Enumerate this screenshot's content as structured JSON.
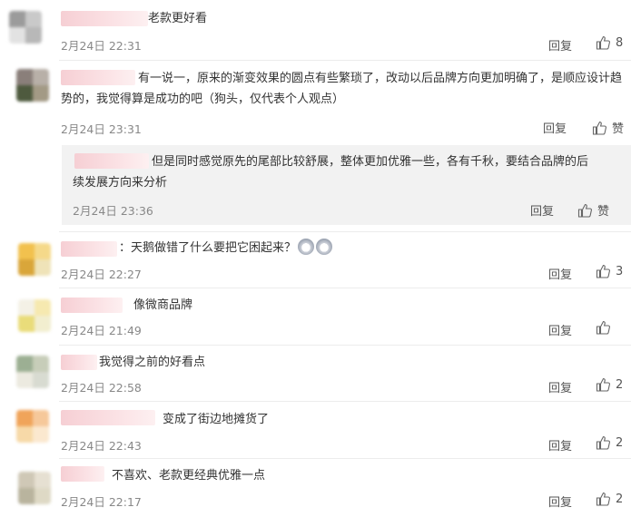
{
  "reply_label": "回复",
  "like_label_zero": "赞",
  "comments": [
    {
      "text": "老款更好看",
      "time": "2月24日 22:31",
      "likes": "8",
      "avatar_colors": [
        "#9b9b9b",
        "#c9c9c9",
        "#e2e2e2",
        "#b8b8b8"
      ]
    },
    {
      "text": "有一说一，原来的渐变效果的圆点有些繁琐了，改动以后品牌方向更加明确了，是顺应设计趋势的，我觉得算是成功的吧（狗头，仅代表个人观点）",
      "time": "2月24日 23:31",
      "likes": "",
      "avatar_colors": [
        "#8a7f7a",
        "#b8b0a8",
        "#4e5a3e",
        "#a39a85"
      ],
      "reply": {
        "text": "但是同时感觉原先的尾部比较舒展，整体更加优雅一些，各有千秋，要结合品牌的后续发展方向来分析",
        "time": "2月24日 23:36",
        "likes": ""
      }
    },
    {
      "text": "：天鹅做错了什么要把它困起来？",
      "time": "2月24日 22:27",
      "likes": "3",
      "avatar_colors": [
        "#f2c14e",
        "#f5d98a",
        "#d9a63a",
        "#efe3b8"
      ]
    },
    {
      "text": "像微商品牌",
      "time": "2月24日 21:49",
      "likes": "",
      "avatar_colors": [
        "#f4f1e6",
        "#f6e9b0",
        "#e9dc7a",
        "#f2eecf"
      ]
    },
    {
      "text": "我觉得之前的好看点",
      "time": "2月24日 22:58",
      "likes": "2",
      "avatar_colors": [
        "#9caf93",
        "#c7cdb9",
        "#eceae0",
        "#d8dbd1"
      ]
    },
    {
      "text": "变成了街边地摊货了",
      "time": "2月24日 22:43",
      "likes": "2",
      "avatar_colors": [
        "#f0a45a",
        "#f6c89a",
        "#f7d9a8",
        "#fbe8cf"
      ]
    },
    {
      "text": "不喜欢、老款更经典优雅一点",
      "time": "2月24日 22:17",
      "likes": "2",
      "avatar_colors": [
        "#cfc8b6",
        "#e6e0d2",
        "#b9b49e",
        "#ded9c5"
      ]
    }
  ]
}
